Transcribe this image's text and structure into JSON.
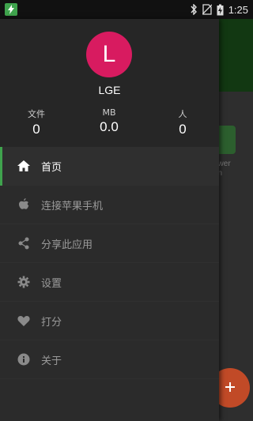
{
  "status_bar": {
    "time": "1:25",
    "icons": [
      "app-notification-icon",
      "bluetooth-icon",
      "no-sim-icon",
      "battery-charging-icon"
    ]
  },
  "background_app": {
    "partial_text_line1": "ower",
    "partial_text_line2": "on",
    "fab_icon": "add-icon"
  },
  "profile": {
    "avatar_letter": "L",
    "username": "LGE",
    "stats": [
      {
        "label": "文件",
        "value": "0"
      },
      {
        "label": "MB",
        "value": "0.0"
      },
      {
        "label": "人",
        "value": "0"
      }
    ]
  },
  "menu": {
    "items": [
      {
        "label": "首页",
        "icon": "home-icon",
        "active": true
      },
      {
        "label": "连接苹果手机",
        "icon": "apple-icon",
        "active": false
      },
      {
        "label": "分享此应用",
        "icon": "share-icon",
        "active": false
      },
      {
        "label": "设置",
        "icon": "gear-icon",
        "active": false
      },
      {
        "label": "打分",
        "icon": "heart-icon",
        "active": false
      },
      {
        "label": "关于",
        "icon": "info-icon",
        "active": false
      }
    ]
  },
  "colors": {
    "accent": "#3fa34d",
    "avatar": "#d81b60",
    "fab": "#c14a27",
    "drawer_bg": "#2b2b2b"
  }
}
